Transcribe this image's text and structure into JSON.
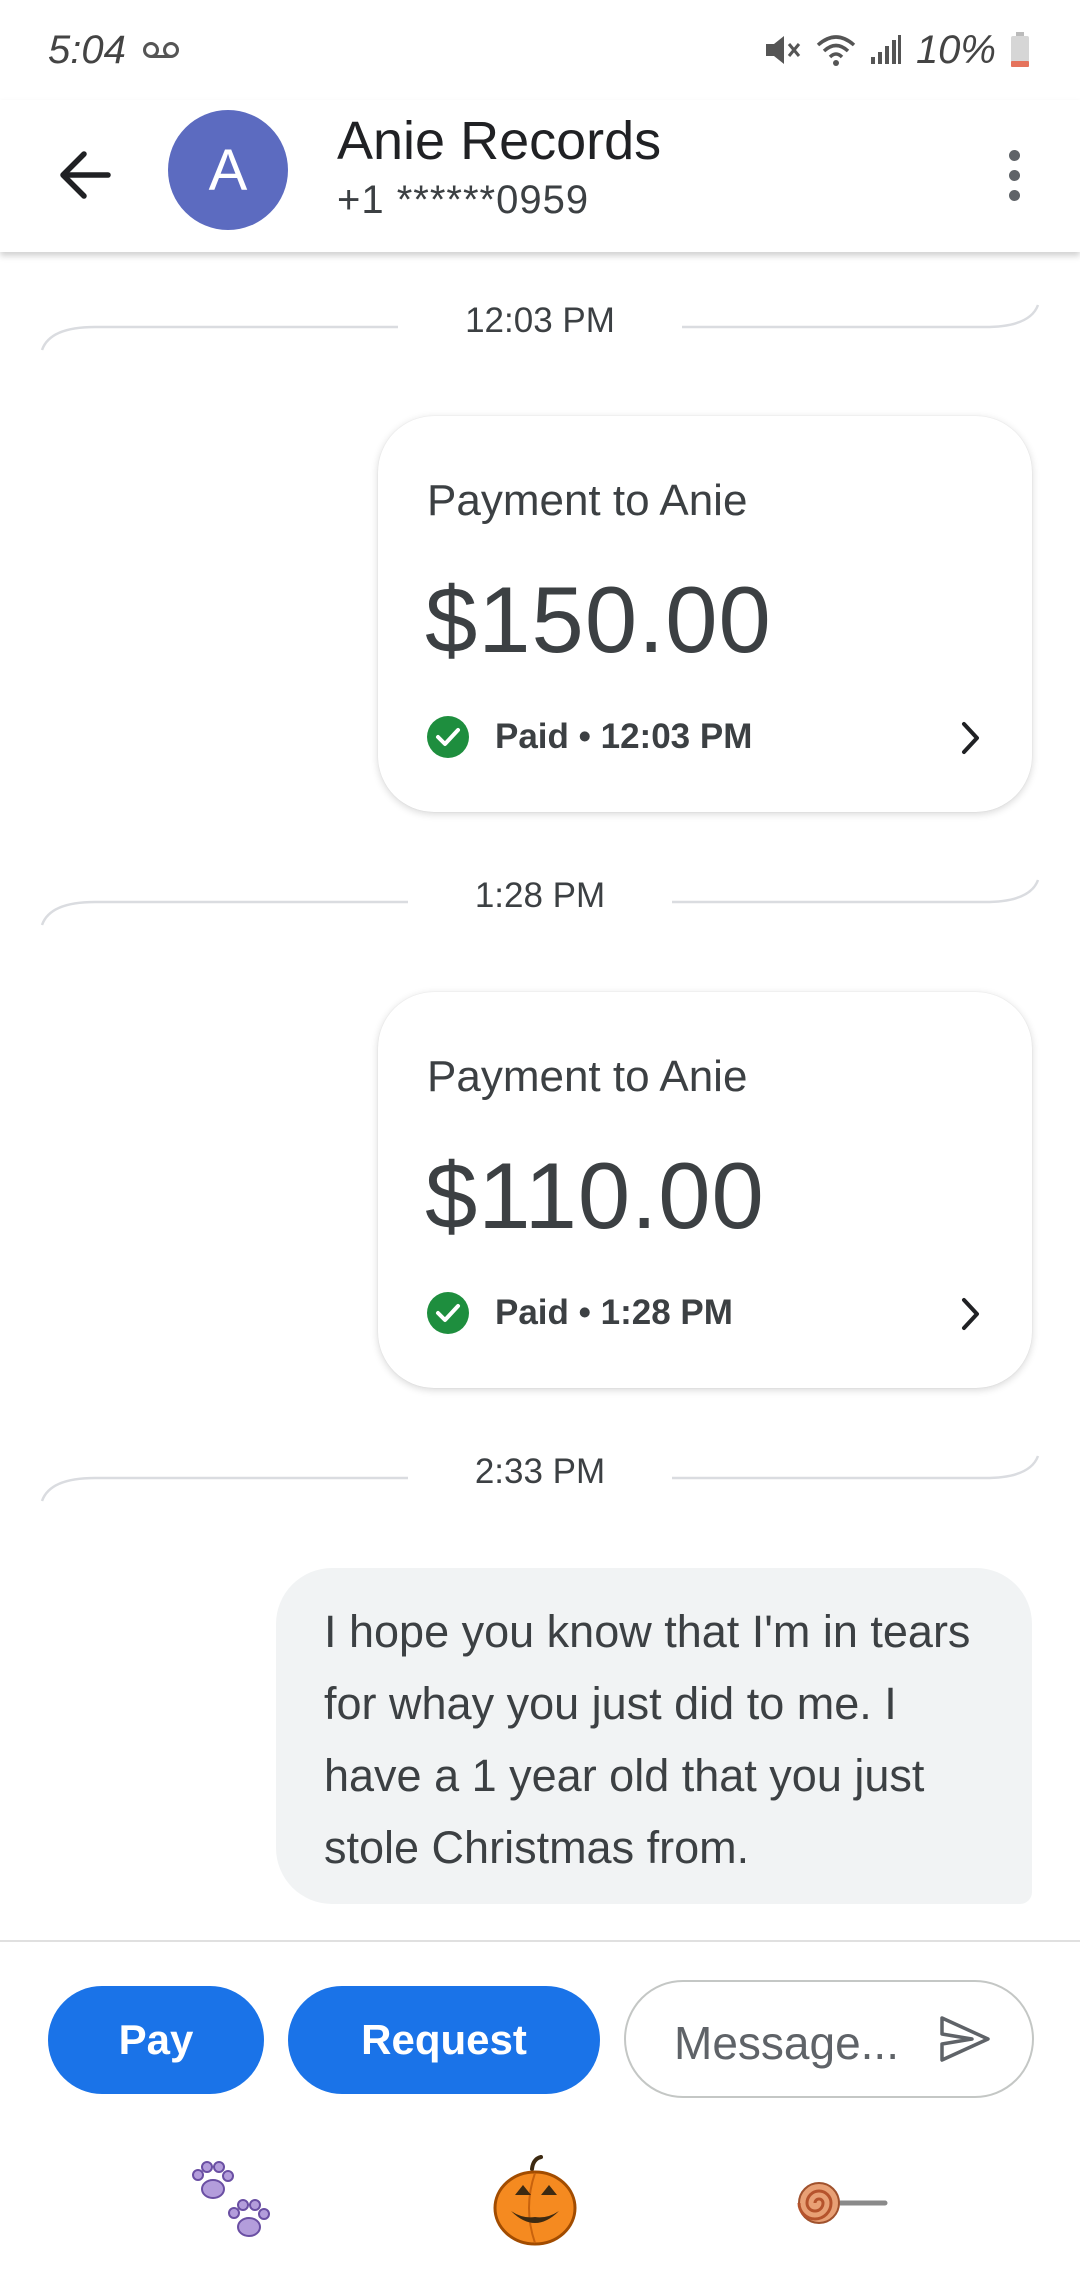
{
  "status_bar": {
    "time": "5:04",
    "battery": "10%",
    "icons": [
      "voicemail-icon",
      "vibrate-mute-icon",
      "wifi-icon",
      "signal-icon",
      "battery-icon"
    ]
  },
  "header": {
    "avatar_letter": "A",
    "contact_name": "Anie Records",
    "phone": "+1 ******0959"
  },
  "conversation": {
    "timestamps": [
      "12:03 PM",
      "1:28 PM",
      "2:33 PM"
    ],
    "payments": [
      {
        "title": "Payment to Anie",
        "amount": "$150.00",
        "status": "Paid • 12:03 PM"
      },
      {
        "title": "Payment to Anie",
        "amount": "$110.00",
        "status": "Paid • 1:28 PM"
      }
    ],
    "message": "I hope you know that I'm in tears for whay you just did to me. I have a 1 year old that you just stole Christmas from."
  },
  "composer": {
    "pay_label": "Pay",
    "request_label": "Request",
    "placeholder": "Message..."
  },
  "stickers": [
    "paw-prints-sticker",
    "jack-o-lantern-sticker",
    "lollipop-sticker"
  ],
  "colors": {
    "primary": "#1a73e8",
    "avatar": "#5c6bc0",
    "paid_green": "#1e8e3e",
    "bubble": "#f1f3f4"
  }
}
